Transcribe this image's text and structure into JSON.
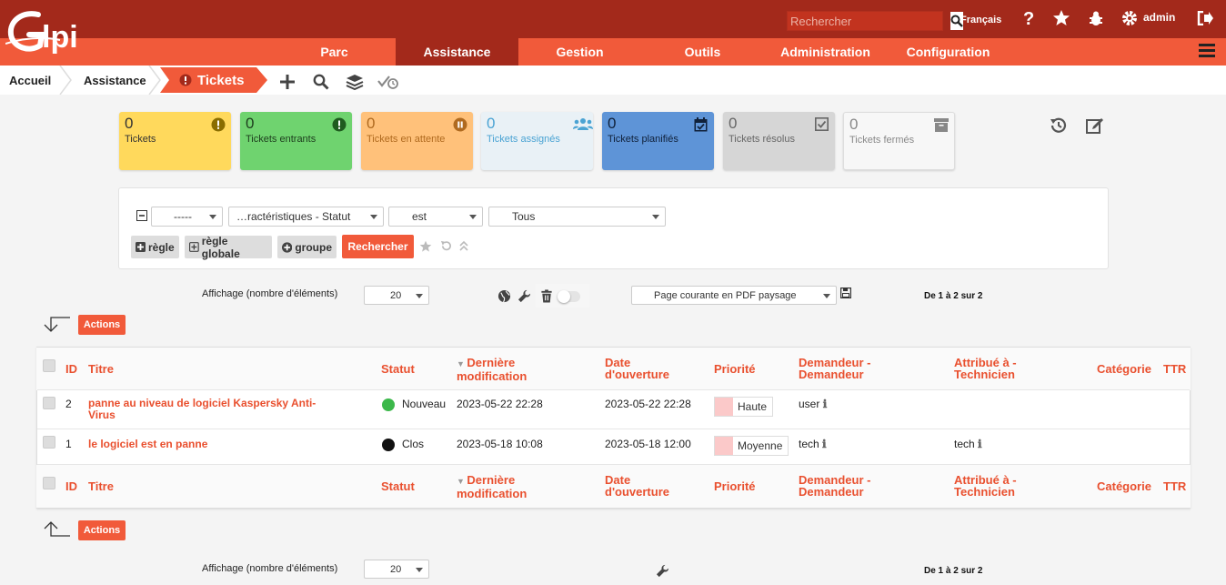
{
  "header": {
    "search_placeholder": "Rechercher",
    "language": "Français",
    "user": "admin"
  },
  "nav": {
    "items": [
      "Parc",
      "Assistance",
      "Gestion",
      "Outils",
      "Administration",
      "Configuration"
    ],
    "active": "Assistance"
  },
  "breadcrumb": {
    "home": "Accueil",
    "section": "Assistance",
    "current": "Tickets"
  },
  "tiles": [
    {
      "count": "0",
      "label": "Tickets",
      "bg": "#ffd95c",
      "fg": "#333333",
      "icon": "exclamation-icon"
    },
    {
      "count": "0",
      "label": "Tickets entrants",
      "bg": "#6fd36f",
      "fg": "#1d3d1d",
      "icon": "exclamation-icon"
    },
    {
      "count": "0",
      "label": "Tickets en attente",
      "bg": "#ffc17a",
      "fg": "#b06a1f",
      "icon": "pause-icon"
    },
    {
      "count": "0",
      "label": "Tickets assignés",
      "bg": "#e9f1f6",
      "fg": "#4aa3d3",
      "icon": "users-icon"
    },
    {
      "count": "0",
      "label": "Tickets planifiés",
      "bg": "#5e94d7",
      "fg": "#10213a",
      "icon": "calendar-icon"
    },
    {
      "count": "0",
      "label": "Tickets résolus",
      "bg": "#d6d6d6",
      "fg": "#666666",
      "icon": "check-square-icon"
    },
    {
      "count": "0",
      "label": "Tickets fermés",
      "bg": "#f7f7f7",
      "fg": "#888888",
      "icon": "archive-icon"
    }
  ],
  "search": {
    "link_select": "-----",
    "field_select": "…ractéristiques - Statut",
    "operator_select": "est",
    "value_select": "Tous",
    "rule_button": "règle",
    "global_rule_button": "règle globale",
    "group_button": "groupe",
    "submit_button": "Rechercher"
  },
  "list_controls": {
    "display_label": "Affichage (nombre d'éléments)",
    "display_value": "20",
    "export_value": "Page courante en PDF paysage",
    "pagination": "De 1 à 2 sur 2",
    "actions_label": "Actions"
  },
  "table": {
    "headers": {
      "id": "ID",
      "title": "Titre",
      "status": "Statut",
      "modified_line1": "Dernière",
      "modified_line2": "modification",
      "opened_line1": "Date",
      "opened_line2": "d'ouverture",
      "priority": "Priorité",
      "requester_line1": "Demandeur -",
      "requester_line2": "Demandeur",
      "assigned_line1": "Attribué à -",
      "assigned_line2": "Technicien",
      "category": "Catégorie",
      "ttr": "TTR"
    },
    "rows": [
      {
        "id": "2",
        "title_line1": "panne au niveau de logiciel Kaspersky Anti-",
        "title_line2": "Virus",
        "status": "Nouveau",
        "status_color": "#3cb84a",
        "modified": "2023-05-22 22:28",
        "opened": "2023-05-22 22:28",
        "priority": "Haute",
        "requester": "user",
        "assigned": ""
      },
      {
        "id": "1",
        "title_line1": "le logiciel est en panne",
        "title_line2": "",
        "status": "Clos",
        "status_color": "#111111",
        "modified": "2023-05-18 10:08",
        "opened": "2023-05-18 12:00",
        "priority": "Moyenne",
        "requester": "tech",
        "assigned": "tech"
      }
    ]
  },
  "colors": {
    "brand_dark": "#a3291b",
    "brand": "#f15a3a",
    "link": "#e9502f"
  }
}
